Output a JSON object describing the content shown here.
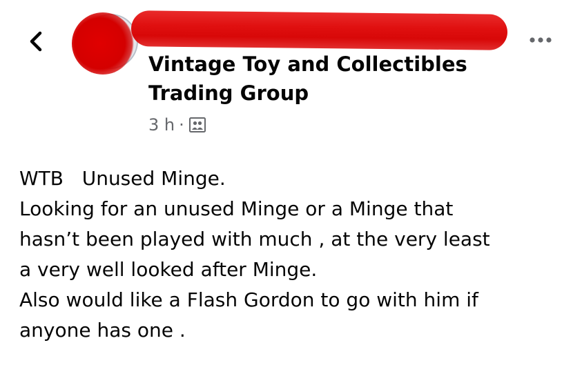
{
  "post": {
    "group_name_line1": "Vintage Toy and Collectibles",
    "group_name_line2": "Trading Group",
    "time": "3 h",
    "separator": "·",
    "audience_icon": "group-audience-icon",
    "more_icon": "more-options-icon",
    "back_icon": "chevron-left-icon",
    "body_lines": [
      "WTB   Unused Minge.",
      "Looking for an unused Minge or a Minge that",
      "hasn’t been played with much , at the very least",
      "a very well looked after Minge.",
      "Also would like a Flash Gordon to go with him if",
      "anyone has one ."
    ]
  },
  "colors": {
    "redaction": "#e01010",
    "meta_text": "#65676b",
    "text": "#050505"
  }
}
